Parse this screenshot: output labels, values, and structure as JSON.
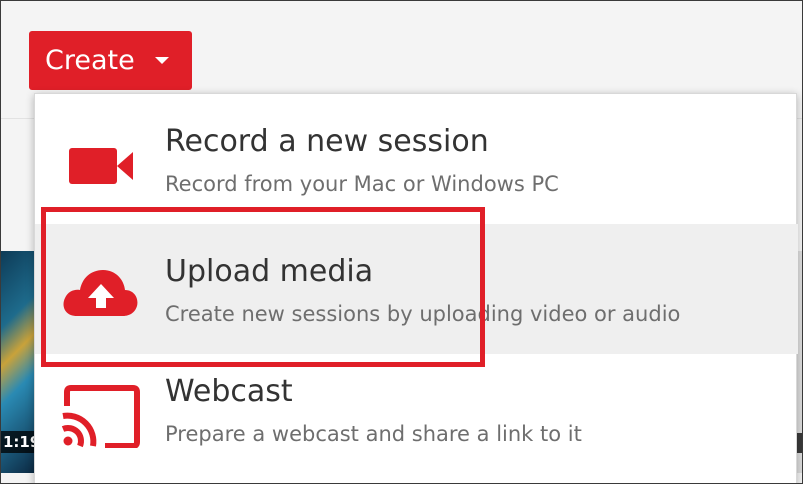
{
  "create_button": {
    "label": "Create"
  },
  "thumbnail_left": {
    "duration_fragment": "1:19"
  },
  "menu": {
    "items": [
      {
        "title": "Record a new session",
        "subtitle": "Record from your Mac or Windows PC",
        "icon": "video-camera-icon"
      },
      {
        "title": "Upload media",
        "subtitle": "Create new sessions by uploading video or audio",
        "icon": "cloud-upload-icon"
      },
      {
        "title": "Webcast",
        "subtitle": "Prepare a webcast and share a link to it",
        "icon": "cast-icon"
      }
    ]
  },
  "colors": {
    "accent": "#e01f28",
    "hover_bg": "#efefef",
    "title_text": "#333333",
    "subtitle_text": "#6e6e6e"
  }
}
